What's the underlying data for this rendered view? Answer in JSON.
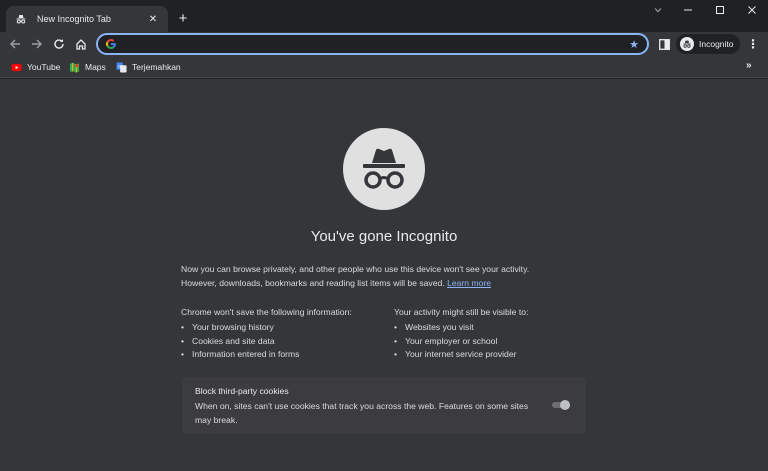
{
  "tab": {
    "title": "New Incognito Tab",
    "close": "✕"
  },
  "newtab": {
    "label": "+"
  },
  "window_controls": {
    "minimize": "—",
    "maximize": "☐",
    "close": "✕"
  },
  "toolbar": {
    "back": "←",
    "forward": "→",
    "reload": "↻",
    "home": "⌂",
    "address_value": "",
    "address_placeholder": "",
    "star": "★",
    "profile_label": "Incognito",
    "menu": "⋮"
  },
  "bookmarks": {
    "items": [
      {
        "label": "YouTube",
        "icon": "youtube-icon"
      },
      {
        "label": "Maps",
        "icon": "maps-icon"
      },
      {
        "label": "Terjemahkan",
        "icon": "translate-icon"
      }
    ],
    "more": "»"
  },
  "content": {
    "heading": "You've gone Incognito",
    "intro_line1": "Now you can browse privately, and other people who use this device won't see your activity.",
    "intro_line2": "However, downloads, bookmarks and reading list items will be saved.",
    "learn_more": "Learn more",
    "left_col": {
      "title": "Chrome won't save the following information:",
      "items": [
        "Your browsing history",
        "Cookies and site data",
        "Information entered in forms"
      ]
    },
    "right_col": {
      "title_part1": "Your activity ",
      "title_bold": "might",
      "title_part2": " still be visible to:",
      "items": [
        "Websites you visit",
        "Your employer or school",
        "Your internet service provider"
      ]
    },
    "cookies": {
      "title": "Block third-party cookies",
      "description": "When on, sites can't use cookies that track you across the web. Features on some sites may break.",
      "enabled": false
    }
  },
  "colors": {
    "frame": "#202124",
    "toolbar": "#35363a",
    "accent": "#8ab4f8",
    "text": "#e8eaed",
    "card": "#3c3c3f"
  }
}
